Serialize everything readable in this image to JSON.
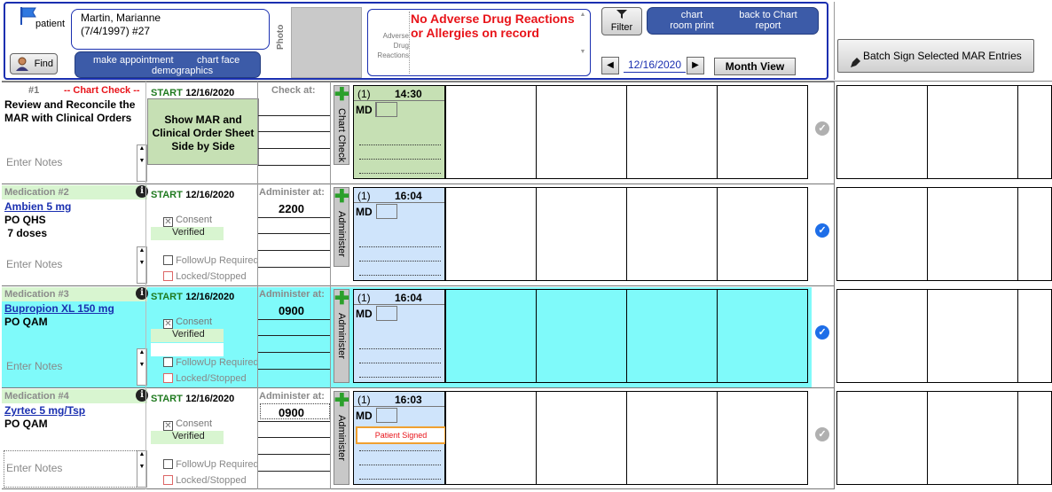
{
  "header": {
    "patient_label": "patient",
    "patient_name": "Martin, Marianne",
    "patient_dob": "(7/4/1997) #27",
    "find_label": "Find",
    "make_appointment": "make appointment",
    "chart_face": "chart face",
    "demographics": "demographics",
    "photo_label": "Photo",
    "adr_label_1": "Adverse",
    "adr_label_2": "Drug",
    "adr_label_3": "Reactions",
    "adr_text": "No Adverse Drug Reactions or Allergies on record",
    "filter_label": "Filter",
    "chart_room_print": "chart room print",
    "back_to_chart_report": "back to  Chart report",
    "date": "12/16/2020",
    "month_view": "Month View",
    "batch_sign": "Batch Sign Selected MAR Entries"
  },
  "rows": [
    {
      "num": "#1",
      "tag": "-- Chart Check --",
      "title_line1": "Review and Reconcile the",
      "title_line2": "MAR with Clinical Orders",
      "start_label": "START",
      "start_date": "12/16/2020",
      "check_at": "Check at:",
      "show_mar": "Show MAR and Clinical Order Sheet Side by Side",
      "notes_placeholder": "Enter Notes",
      "action": "Chart Check",
      "entry_count": "(1)",
      "entry_time": "14:30",
      "entry_role": "MD"
    },
    {
      "med": "Medication #2",
      "drug": "Ambien 5 mg",
      "route": "PO QHS",
      "doses": " 7 doses",
      "start_label": "START",
      "start_date": "12/16/2020",
      "admin_at": "Administer at:",
      "admin_time": "2200",
      "consent": "Consent",
      "verified": "Verified",
      "followup": "FollowUp Required",
      "locked": "Locked/Stopped",
      "notes_placeholder": "Enter Notes",
      "action": "Administer",
      "entry_count": "(1)",
      "entry_time": "16:04",
      "entry_role": "MD"
    },
    {
      "med": "Medication #3",
      "drug": "Bupropion XL 150 mg",
      "route": "PO QAM",
      "start_label": "START",
      "start_date": "12/16/2020",
      "admin_at": "Administer at:",
      "admin_time": "0900",
      "consent": "Consent",
      "verified": "Verified",
      "followup": "FollowUp Required",
      "locked": "Locked/Stopped",
      "notes_placeholder": "Enter Notes",
      "action": "Administer",
      "entry_count": "(1)",
      "entry_time": "16:04",
      "entry_role": "MD"
    },
    {
      "med": "Medication #4",
      "drug": "Zyrtec 5 mg/Tsp",
      "route": "PO QAM",
      "start_label": "START",
      "start_date": "12/16/2020",
      "admin_at": "Administer at:",
      "admin_time": "0900",
      "consent": "Consent",
      "verified": "Verified",
      "followup": "FollowUp Required",
      "locked": "Locked/Stopped",
      "notes_placeholder": "Enter Notes",
      "action": "Administer",
      "entry_count": "(1)",
      "entry_time": "16:03",
      "entry_role": "MD",
      "patient_signed": "Patient Signed"
    }
  ],
  "colors": {
    "header_border": "#1a2fb0",
    "pill_blue": "#3c5ba8",
    "green_entry": "#c6e0b4",
    "blue_entry": "#cfe4fb",
    "cyan_row": "#7ffafa",
    "consent_green": "#d8f5d0",
    "alert_red": "#e8141a"
  }
}
